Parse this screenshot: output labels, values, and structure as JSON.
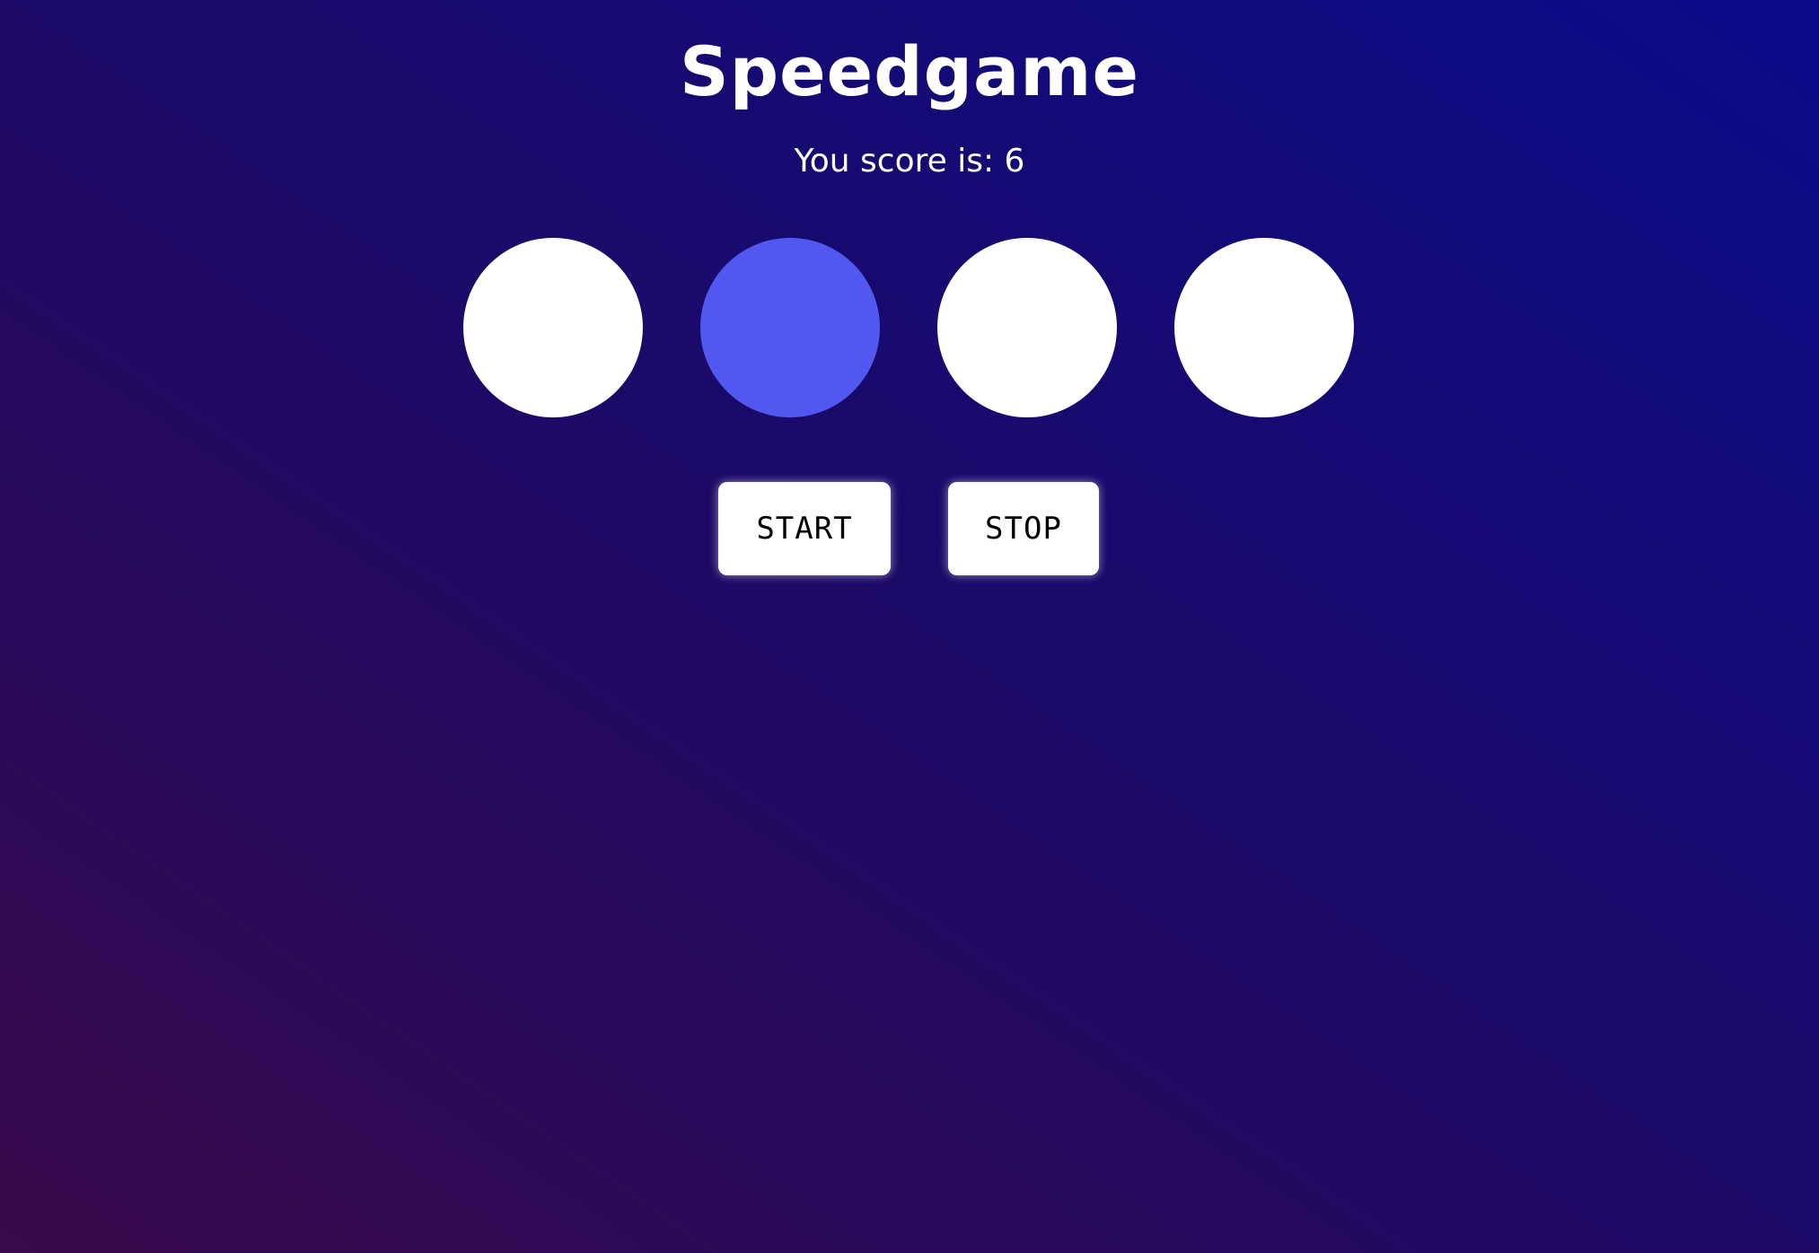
{
  "game": {
    "title": "Speedgame",
    "score_label": "You score is:",
    "score_value": "6",
    "circles": [
      {
        "id": 1,
        "active": false
      },
      {
        "id": 2,
        "active": true
      },
      {
        "id": 3,
        "active": false
      },
      {
        "id": 4,
        "active": false
      }
    ],
    "buttons": {
      "start_label": "START",
      "stop_label": "STOP"
    }
  },
  "colors": {
    "circle_default": "#ffffff",
    "circle_active": "#5257f0",
    "background_top_right": "#0a0a88",
    "background_bottom_left": "#3a0a4a"
  }
}
